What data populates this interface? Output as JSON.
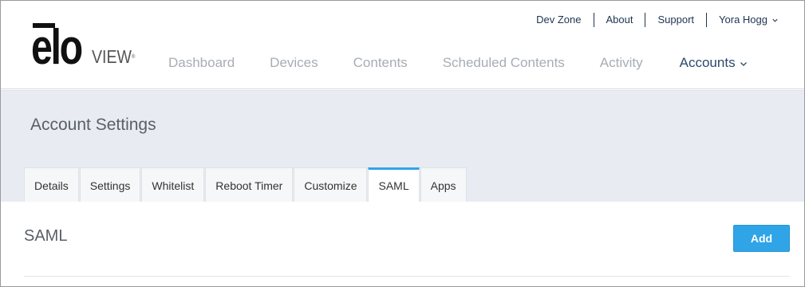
{
  "brand": {
    "logo_primary": "elo",
    "logo_secondary": "VIEW",
    "logo_mark": "®"
  },
  "utility_links": [
    {
      "label": "Dev Zone"
    },
    {
      "label": "About"
    },
    {
      "label": "Support"
    }
  ],
  "user": {
    "name": "Yora Hogg",
    "icon": "chevron-down-icon"
  },
  "main_nav": [
    {
      "label": "Dashboard"
    },
    {
      "label": "Devices"
    },
    {
      "label": "Contents"
    },
    {
      "label": "Scheduled Contents"
    },
    {
      "label": "Activity"
    },
    {
      "label": "Accounts",
      "active": true
    }
  ],
  "page": {
    "title": "Account Settings"
  },
  "sub_tabs": [
    {
      "label": "Details"
    },
    {
      "label": "Settings"
    },
    {
      "label": "Whitelist"
    },
    {
      "label": "Reboot Timer"
    },
    {
      "label": "Customize"
    },
    {
      "label": "SAML",
      "active": true
    },
    {
      "label": "Apps"
    }
  ],
  "section": {
    "title": "SAML",
    "add_label": "Add"
  },
  "colors": {
    "accent": "#2fa4e7",
    "band_bg": "#e8ebf2",
    "nav_active": "#2c4a6a",
    "nav_inactive": "#a7adb4"
  }
}
